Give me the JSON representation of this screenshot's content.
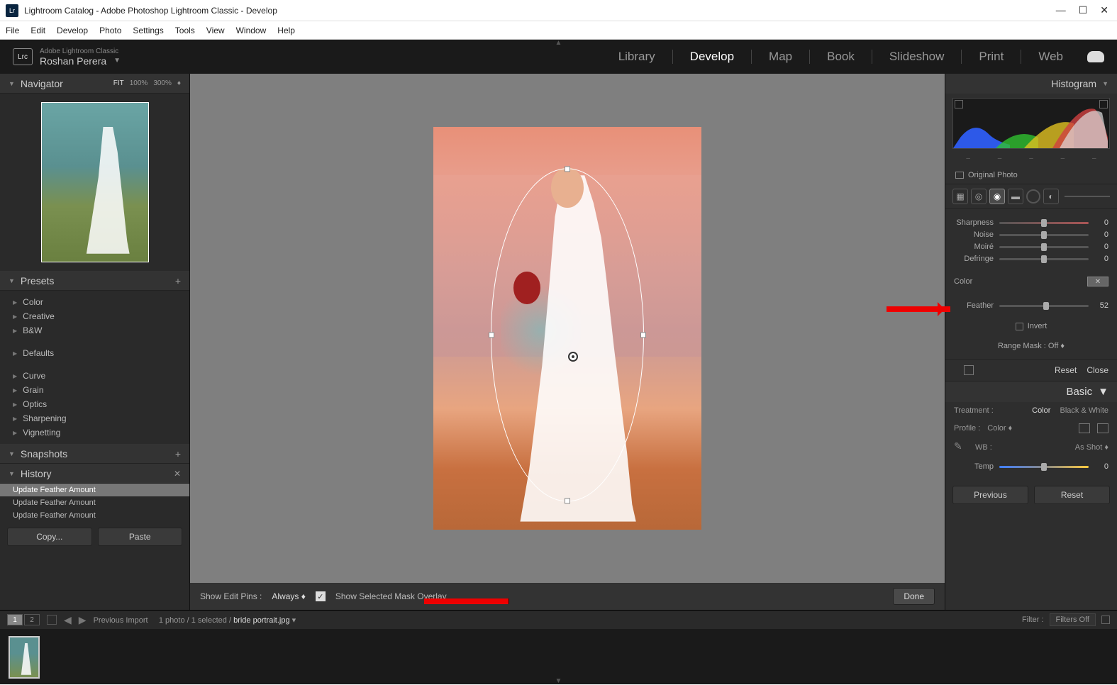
{
  "window": {
    "title": "Lightroom Catalog - Adobe Photoshop Lightroom Classic - Develop",
    "icon_text": "Lr"
  },
  "menu": [
    "File",
    "Edit",
    "Develop",
    "Photo",
    "Settings",
    "Tools",
    "View",
    "Window",
    "Help"
  ],
  "identity": {
    "product": "Adobe Lightroom Classic",
    "user": "Roshan Perera",
    "lrc": "Lrc"
  },
  "modules": [
    "Library",
    "Develop",
    "Map",
    "Book",
    "Slideshow",
    "Print",
    "Web"
  ],
  "active_module": "Develop",
  "left": {
    "navigator": {
      "title": "Navigator",
      "zoom": [
        "FIT",
        "100%",
        "300%"
      ]
    },
    "presets": {
      "title": "Presets",
      "groups": [
        "Color",
        "Creative",
        "B&W"
      ],
      "groups2": [
        "Defaults"
      ],
      "groups3": [
        "Curve",
        "Grain",
        "Optics",
        "Sharpening",
        "Vignetting"
      ]
    },
    "snapshots": {
      "title": "Snapshots"
    },
    "history": {
      "title": "History",
      "items": [
        "Update Feather Amount",
        "Update Feather Amount",
        "Update Feather Amount"
      ]
    },
    "copy": "Copy...",
    "paste": "Paste"
  },
  "center": {
    "show_pins_label": "Show Edit Pins :",
    "show_pins_value": "Always",
    "mask_overlay": "Show Selected Mask Overlay",
    "done": "Done"
  },
  "right": {
    "histogram": "Histogram",
    "original": "Original Photo",
    "sliders": {
      "sharpness": {
        "label": "Sharpness",
        "value": "0",
        "pos": 50
      },
      "noise": {
        "label": "Noise",
        "value": "0",
        "pos": 50
      },
      "moire": {
        "label": "Moiré",
        "value": "0",
        "pos": 50
      },
      "defringe": {
        "label": "Defringe",
        "value": "0",
        "pos": 50
      },
      "feather": {
        "label": "Feather",
        "value": "52",
        "pos": 52
      }
    },
    "color_label": "Color",
    "invert": "Invert",
    "range_mask": "Range Mask :",
    "range_mask_val": "Off",
    "reset": "Reset",
    "close": "Close",
    "basic": "Basic",
    "treatment": {
      "label": "Treatment :",
      "color": "Color",
      "bw": "Black & White"
    },
    "profile": {
      "label": "Profile :",
      "value": "Color"
    },
    "wb": {
      "label": "WB :",
      "value": "As Shot"
    },
    "temp": {
      "label": "Temp",
      "value": "0"
    },
    "previous": "Previous",
    "reset2": "Reset"
  },
  "filmstrip": {
    "crumb_source": "Previous Import",
    "crumb_count": "1 photo / 1 selected /",
    "crumb_file": "bride portrait.jpg",
    "filter_label": "Filter :",
    "filter_value": "Filters Off"
  }
}
